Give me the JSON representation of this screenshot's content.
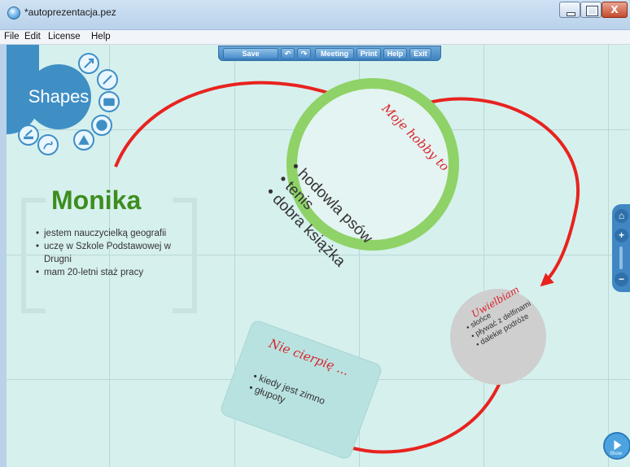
{
  "window": {
    "title": "*autoprezentacja.pez",
    "close_label": "X"
  },
  "menu": [
    "File",
    "Edit",
    "License",
    "Help"
  ],
  "toolbar": {
    "save": "Save",
    "meeting": "Meeting",
    "print": "Print",
    "help": "Help",
    "exit": "Exit"
  },
  "shapes_panel": {
    "label": "Shapes"
  },
  "profile": {
    "name": "Monika",
    "bullets": [
      "jestem nauczycielką geografii",
      "uczę w Szkole Podstawowej w Drugni",
      "mam 20-letni staż pracy"
    ]
  },
  "hobby": {
    "title": "Moje hobby to",
    "items": [
      "hodowla psów",
      "tenis",
      "dobra książka"
    ]
  },
  "uwielbiam": {
    "title": "Uwielbiam",
    "items": [
      "słońce",
      "pływać z delfinami",
      "dalekie podróże"
    ]
  },
  "nie_cierpie": {
    "title": "Nie cierpię ...",
    "items": [
      "kiedy jest zimno",
      "głupoty"
    ]
  },
  "zoom": {
    "home": "⌂",
    "zoom_in": "+",
    "zoom_out": "−"
  },
  "show_label": "Show",
  "colors": {
    "canvas": "#d6f0ee",
    "accent_blue": "#3f8fc5",
    "green": "#8fd267",
    "red": "#d8232a"
  }
}
